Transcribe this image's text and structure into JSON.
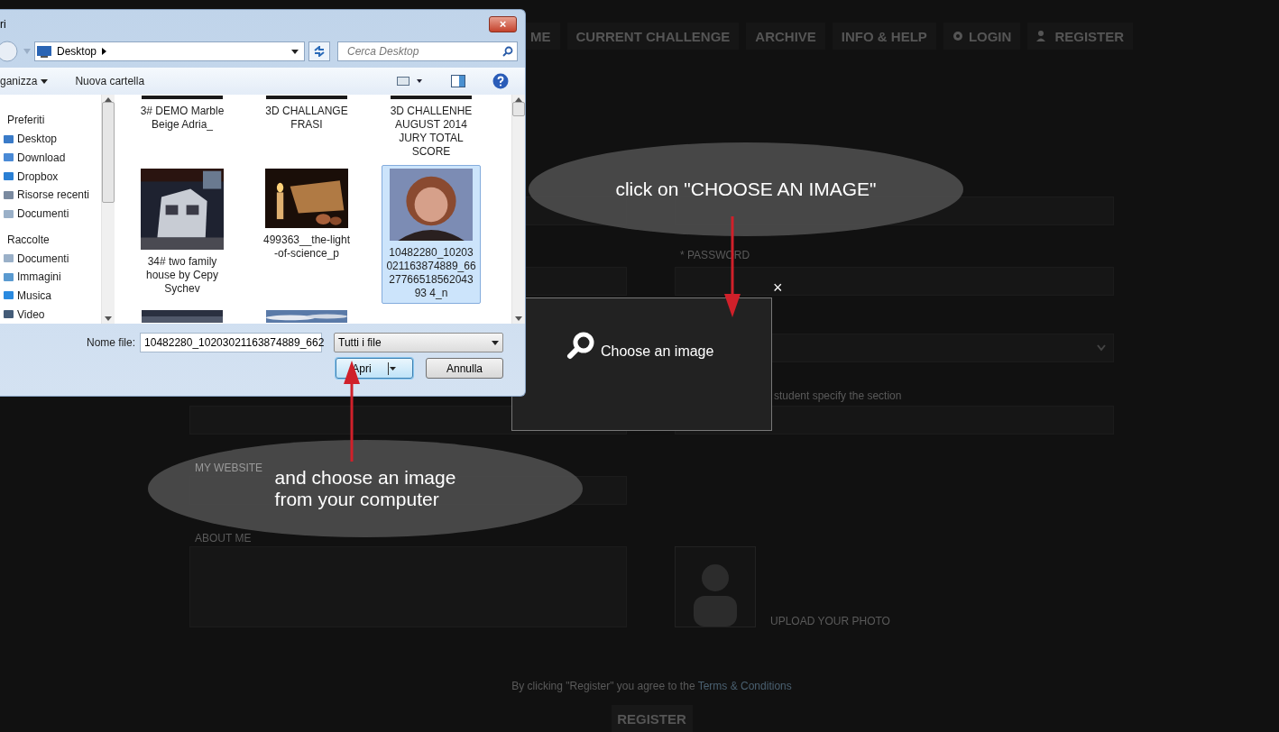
{
  "nav": [
    {
      "label": "ME"
    },
    {
      "label": "CURRENT CHALLENGE"
    },
    {
      "label": "ARCHIVE"
    },
    {
      "label": "INFO & HELP"
    },
    {
      "label": "LOGIN"
    },
    {
      "label": "REGISTER"
    }
  ],
  "form": {
    "password_label": "* PASSWORD",
    "section_hint": "student specify the section",
    "website_label": "MY WEBSITE",
    "about_label": "ABOUT ME",
    "photo_label": "UPLOAD YOUR PHOTO"
  },
  "terms": {
    "text": "By clicking \"Register\" you agree to the",
    "link": "Terms & Conditions"
  },
  "register_button": "REGISTER",
  "dialog": {
    "title": "ri",
    "close": "×",
    "address": "Desktop",
    "search": {
      "placeholder": "Cerca Desktop"
    },
    "toolbar": [
      {
        "label": "ganizza",
        "kind": "menu"
      },
      {
        "label": "Nuova cartella",
        "kind": "plain"
      }
    ],
    "sidebar": [
      {
        "label": "Preferiti",
        "kind": "group"
      },
      {
        "label": "Desktop",
        "kind": "item"
      },
      {
        "label": "Download",
        "kind": "item"
      },
      {
        "label": "Dropbox",
        "kind": "item"
      },
      {
        "label": "Risorse recenti",
        "kind": "item"
      },
      {
        "label": "Documenti",
        "kind": "item"
      },
      {
        "label": "Raccolte",
        "kind": "group"
      },
      {
        "label": "Documenti",
        "kind": "item"
      },
      {
        "label": "Immagini",
        "kind": "item"
      },
      {
        "label": "Musica",
        "kind": "item"
      },
      {
        "label": "Video",
        "kind": "item"
      }
    ],
    "files": [
      {
        "label": "3# DEMO Marble Beige Adria_",
        "selected": false
      },
      {
        "label": "3D CHALLANGE FRASI",
        "selected": false
      },
      {
        "label": "3D CHALLENHE AUGUST 2014 JURY TOTAL SCORE",
        "selected": false
      },
      {
        "label": "34# two family house by Cepy Sychev",
        "selected": false
      },
      {
        "label": "499363__the-light -of-science_p",
        "selected": false
      },
      {
        "label": "10482280_10203021163874889_662776651856204393 4_n",
        "selected": true
      },
      {
        "selected": false
      },
      {
        "selected": false
      }
    ],
    "file_name_label": "Nome file:",
    "file_name": "10482280_10203021163874889_662",
    "file_type": "Tutti i file",
    "buttons": [
      {
        "label": "Apri",
        "kind": "split",
        "focused": true
      },
      {
        "label": "Annulla",
        "kind": "plain",
        "focused": false
      }
    ]
  },
  "modal": {
    "close": "×",
    "label": "Choose an image"
  },
  "callouts": [
    {
      "text": "click on \"CHOOSE AN IMAGE\""
    },
    {
      "text": "and choose an image\nfrom your computer"
    }
  ]
}
